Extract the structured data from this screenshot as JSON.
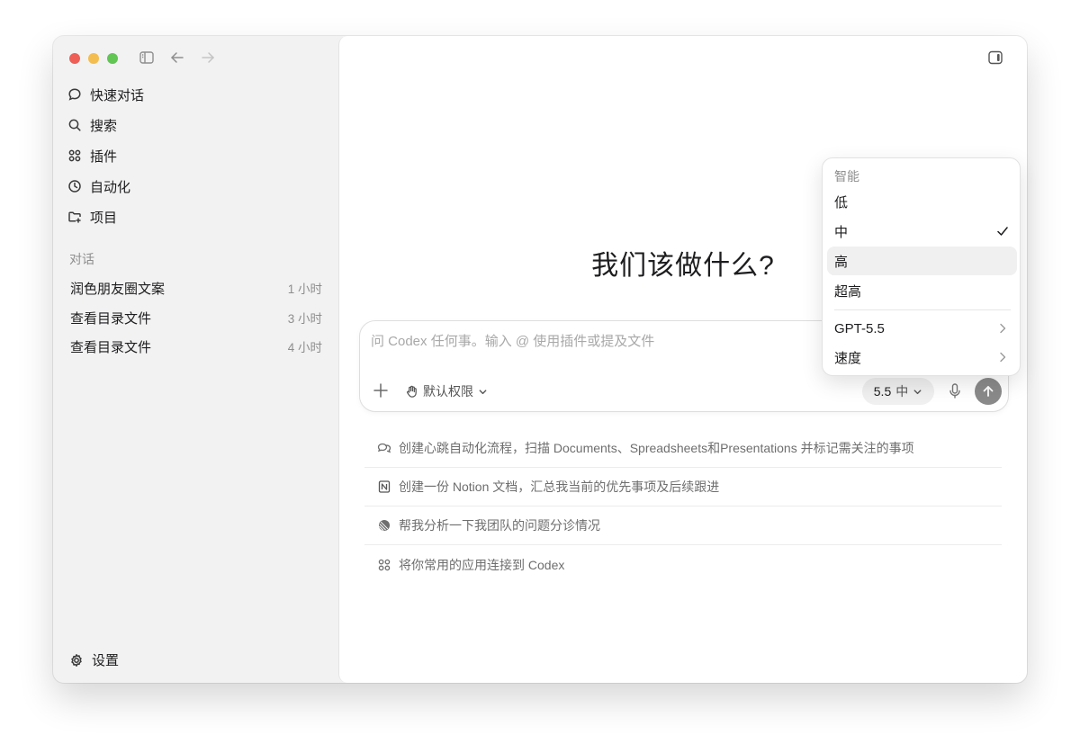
{
  "sidebar": {
    "nav": [
      {
        "label": "快速对话",
        "icon": "chat-bubble-icon"
      },
      {
        "label": "搜索",
        "icon": "search-icon"
      },
      {
        "label": "插件",
        "icon": "grid-icon"
      },
      {
        "label": "自动化",
        "icon": "clock-icon"
      },
      {
        "label": "项目",
        "icon": "folder-plus-icon"
      }
    ],
    "section_label": "对话",
    "chats": [
      {
        "title": "润色朋友圈文案",
        "time": "1 小时"
      },
      {
        "title": "查看目录文件",
        "time": "3 小时"
      },
      {
        "title": "查看目录文件",
        "time": "4 小时"
      }
    ],
    "settings_label": "设置"
  },
  "main": {
    "heading": "我们该做什么?",
    "composer": {
      "placeholder": "问 Codex 任何事。输入 @ 使用插件或提及文件",
      "permission_label": "默认权限",
      "model_label": "5.5",
      "level_label": "中"
    },
    "suggestions": [
      {
        "text": "创建心跳自动化流程，扫描 Documents、Spreadsheets和Presentations 并标记需关注的事项",
        "icon": "chat-loop-icon"
      },
      {
        "text": "创建一份 Notion 文档，汇总我当前的优先事项及后续跟进",
        "icon": "notion-icon"
      },
      {
        "text": "帮我分析一下我团队的问题分诊情况",
        "icon": "linear-icon"
      },
      {
        "text": "将你常用的应用连接到 Codex",
        "icon": "apps-grid-icon"
      }
    ]
  },
  "menu": {
    "header": "智能",
    "items": [
      {
        "label": "低"
      },
      {
        "label": "中",
        "checked": true
      },
      {
        "label": "高",
        "highlighted": true
      },
      {
        "label": "超高"
      }
    ],
    "submenus": [
      {
        "label": "GPT-5.5"
      },
      {
        "label": "速度"
      }
    ]
  },
  "colors": {
    "sidebar_bg": "#f2f2f2",
    "main_bg": "#ffffff",
    "send_button": "#8a8a8a",
    "traffic_red": "#ee5f57",
    "traffic_yellow": "#f4bd4f",
    "traffic_green": "#62c554"
  }
}
